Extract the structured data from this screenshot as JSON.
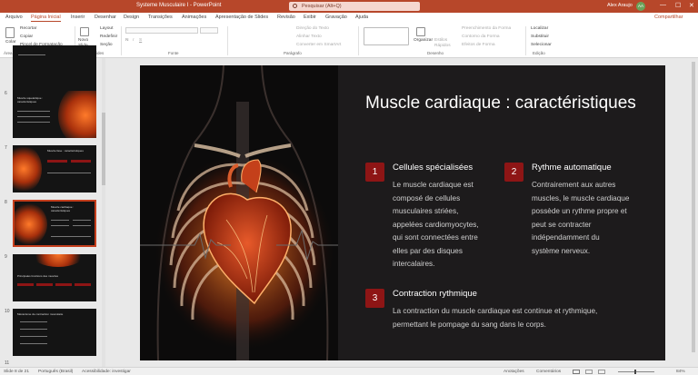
{
  "titlebar": {
    "document": "Systeme Musculaire I  -  PowerPoint",
    "search_placeholder": "Pesquisar (Alt+Q)",
    "user": "Alex Araujo",
    "avatar": "AA",
    "min": "—",
    "max": "☐",
    "close": "✕"
  },
  "tabs": [
    "Arquivo",
    "Página Inicial",
    "Inserir",
    "Desenhar",
    "Design",
    "Transições",
    "Animações",
    "Apresentação de Slides",
    "Revisão",
    "Exibir",
    "Gravação",
    "Ajuda"
  ],
  "share": "Compartilhar",
  "ribbon": {
    "clipboard": {
      "paste": "Colar",
      "cut": "Recortar",
      "copy": "Copiar",
      "format_painter": "Pincel de Formatação",
      "label": "Área de Transferência"
    },
    "slides": {
      "new_slide": "Novo Slide",
      "layout": "Layout",
      "reset": "Redefinir",
      "section": "Seção",
      "label": "Slides"
    },
    "font": {
      "label": "Fonte",
      "bold": "N",
      "italic": "I",
      "underline": "S"
    },
    "paragraph": {
      "text_direction": "Direção do Texto",
      "align_text": "Alinhar Texto",
      "smartart": "Converter em SmartArt",
      "label": "Parágrafo"
    },
    "drawing": {
      "arrange": "Organizar",
      "quick_styles": "Estilos Rápidos",
      "fill": "Preenchimento da Forma",
      "outline": "Contorno da Forma",
      "effects": "Efeitos de Forma",
      "label": "Desenho"
    },
    "editing": {
      "find": "Localizar",
      "replace": "Substituir",
      "select": "Selecionar",
      "label": "Edição"
    }
  },
  "thumbnails": [
    {
      "number": ""
    },
    {
      "number": "6",
      "title": "Muscle squelettique : caractéristiques"
    },
    {
      "number": "7",
      "title": "Muscle lisse : caractéristiques"
    },
    {
      "number": "8",
      "title": "Muscle cardiaque : caractéristiques"
    },
    {
      "number": "9",
      "title": "Principales fonctions des muscles"
    },
    {
      "number": "10",
      "title": "Mécanisme de contraction musculaire"
    },
    {
      "number": "11"
    }
  ],
  "slide": {
    "title": "Muscle cardiaque : caractéristiques",
    "features": [
      {
        "num": "1",
        "title": "Cellules spécialisées",
        "lines": [
          "Le muscle cardiaque est",
          "composé de cellules",
          "musculaires striées,",
          "appelées cardiomyocytes,",
          "qui sont connectées entre",
          "elles par des disques",
          "intercalaires."
        ]
      },
      {
        "num": "2",
        "title": "Rythme automatique",
        "lines": [
          "Contrairement aux autres",
          "muscles, le muscle cardiaque",
          "possède un rythme propre et",
          "peut se contracter",
          "indépendamment du",
          "système nerveux."
        ]
      },
      {
        "num": "3",
        "title": "Contraction rythmique",
        "lines": [
          "La contraction du muscle cardiaque est continue et rythmique,",
          "permettant le pompage du sang dans le corps."
        ]
      }
    ]
  },
  "status": {
    "slide": "Slide 8 de 21",
    "language": "Português (Brasil)",
    "accessibility": "Acessibilidade: investigar",
    "notes": "Anotações",
    "comments": "Comentários",
    "zoom": "84%"
  }
}
